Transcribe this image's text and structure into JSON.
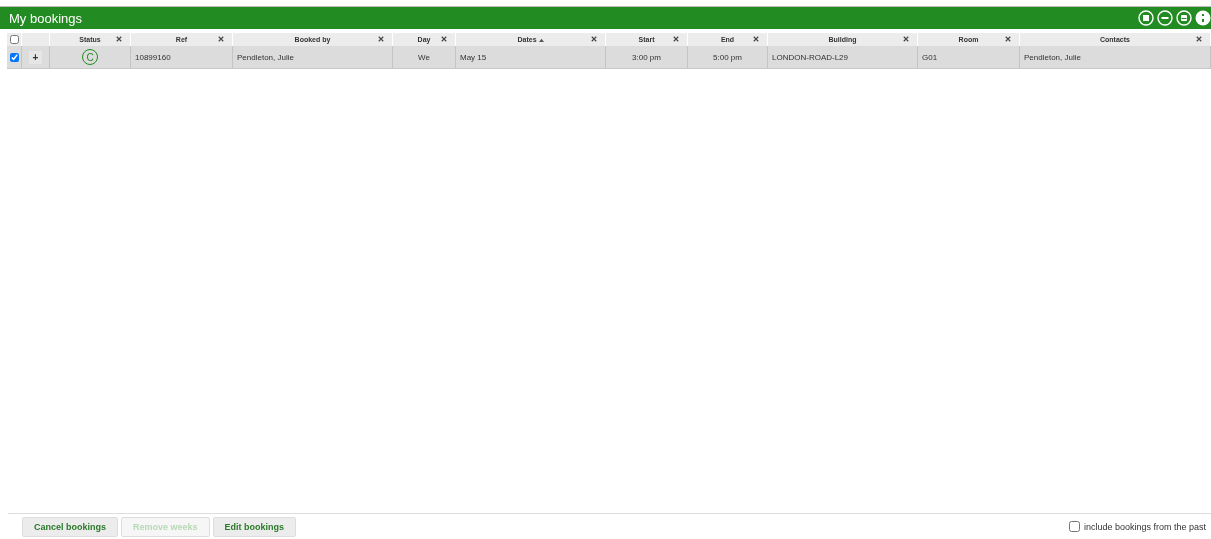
{
  "panel": {
    "title": "My bookings"
  },
  "table": {
    "select_all": {
      "checked": false
    },
    "columns": [
      {
        "label": "Status",
        "kind": "status",
        "sorted": false
      },
      {
        "label": "Ref",
        "kind": "text",
        "sorted": false
      },
      {
        "label": "Booked by",
        "kind": "text",
        "sorted": false
      },
      {
        "label": "Day",
        "kind": "text",
        "sorted": false
      },
      {
        "label": "Dates",
        "kind": "text",
        "sorted": true
      },
      {
        "label": "Start",
        "kind": "text",
        "sorted": false
      },
      {
        "label": "End",
        "kind": "text",
        "sorted": false
      },
      {
        "label": "Building",
        "kind": "text",
        "sorted": false
      },
      {
        "label": "Room",
        "kind": "text",
        "sorted": false
      },
      {
        "label": "Contacts",
        "kind": "text",
        "sorted": false
      }
    ],
    "rows": [
      {
        "checked": true,
        "expand": "+",
        "cells": [
          "C",
          "10899160",
          "Pendleton, Julie",
          "We",
          "May 15",
          "3:00 pm",
          "5:00 pm",
          "LONDON-ROAD-L29",
          "G01",
          "Pendleton, Julie"
        ]
      }
    ]
  },
  "buttons": [
    {
      "label": "Cancel bookings",
      "disabled": false
    },
    {
      "label": "Remove weeks",
      "disabled": true
    },
    {
      "label": "Edit bookings",
      "disabled": false
    }
  ],
  "past_option": {
    "label": "include bookings from the past",
    "checked": false
  }
}
